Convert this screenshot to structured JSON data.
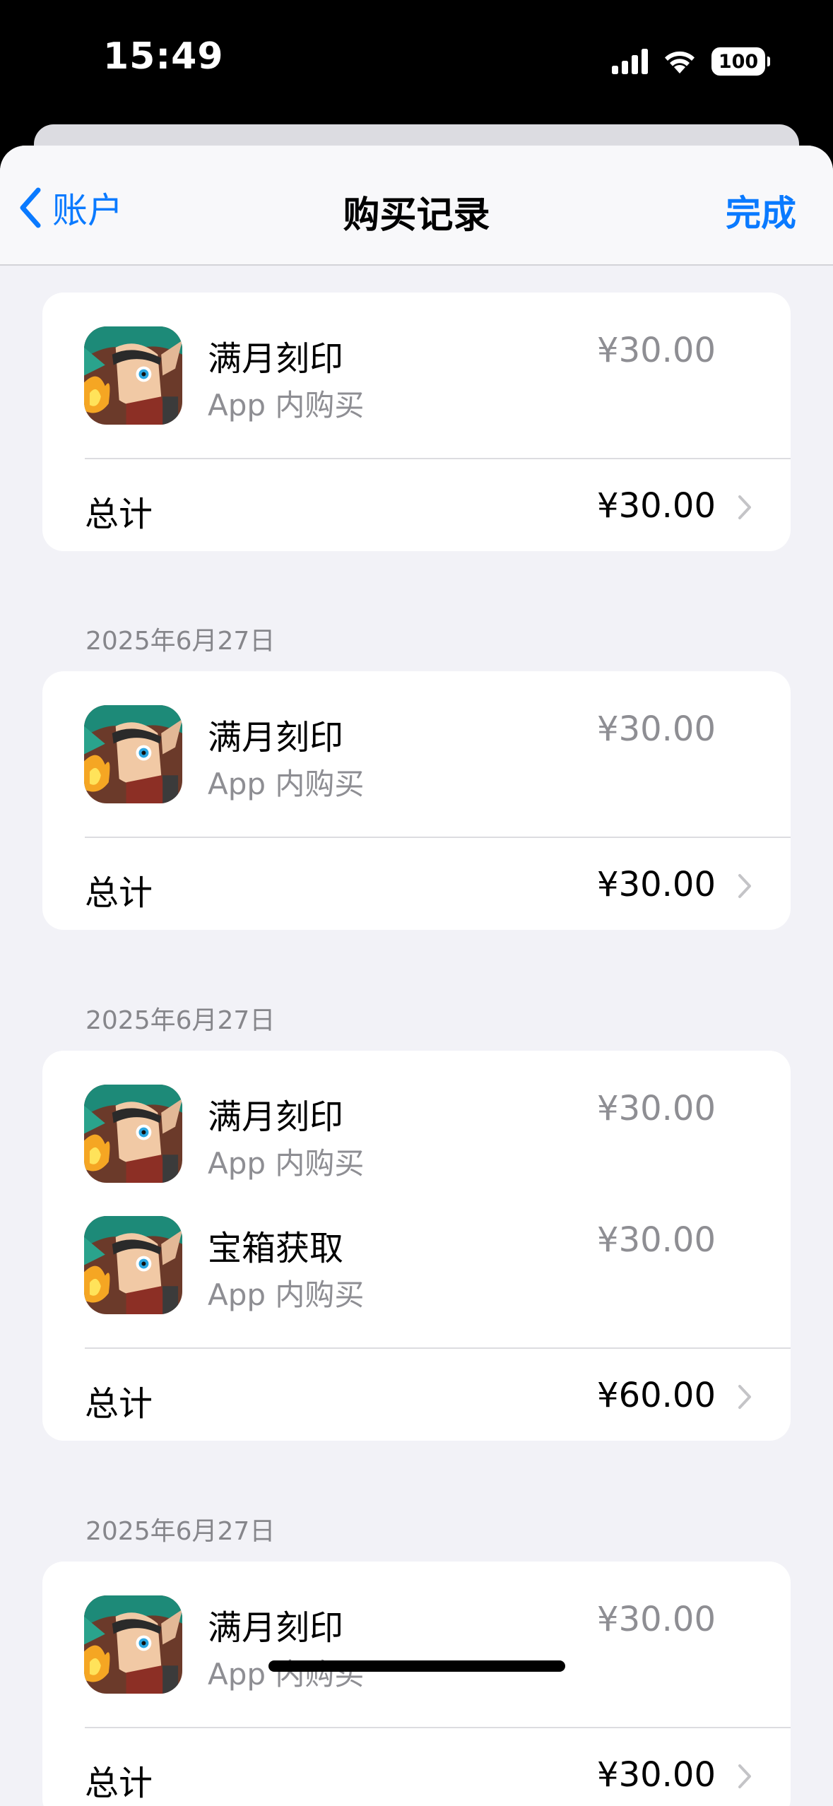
{
  "status_bar": {
    "time": "15:49",
    "battery": "100"
  },
  "nav": {
    "back_label": "账户",
    "title": "购买记录",
    "done_label": "完成"
  },
  "colors": {
    "accent": "#0A7AFF",
    "background": "#F2F2F7",
    "secondary_text": "#8E8E93"
  },
  "purchase_groups": [
    {
      "date": "",
      "items": [
        {
          "name": "满月刻印",
          "type": "App 内购买",
          "price": "¥30.00",
          "icon": "game-app-icon"
        }
      ],
      "total_label": "总计",
      "total": "¥30.00"
    },
    {
      "date": "2025年6月27日",
      "items": [
        {
          "name": "满月刻印",
          "type": "App 内购买",
          "price": "¥30.00",
          "icon": "game-app-icon"
        }
      ],
      "total_label": "总计",
      "total": "¥30.00"
    },
    {
      "date": "2025年6月27日",
      "items": [
        {
          "name": "满月刻印",
          "type": "App 内购买",
          "price": "¥30.00",
          "icon": "game-app-icon"
        },
        {
          "name": "宝箱获取",
          "type": "App 内购买",
          "price": "¥30.00",
          "icon": "game-app-icon"
        }
      ],
      "total_label": "总计",
      "total": "¥60.00"
    },
    {
      "date": "2025年6月27日",
      "items": [
        {
          "name": "满月刻印",
          "type": "App 内购买",
          "price": "¥30.00",
          "icon": "game-app-icon"
        }
      ],
      "total_label": "总计",
      "total": "¥30.00"
    }
  ]
}
